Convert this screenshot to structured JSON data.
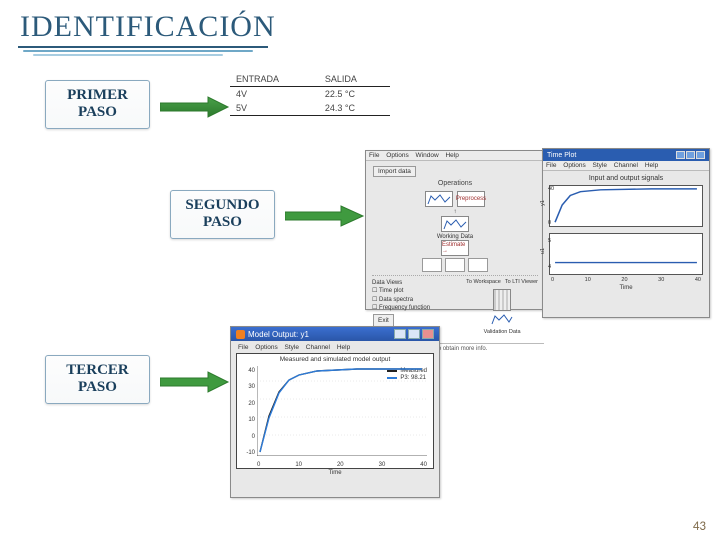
{
  "title": "IDENTIFICACIÓN",
  "page_number": "43",
  "steps": {
    "first": {
      "line1": "PRIMER",
      "line2": "PASO"
    },
    "second": {
      "line1": "SEGUNDO",
      "line2": "PASO"
    },
    "third": {
      "line1": "TERCER",
      "line2": "PASO"
    }
  },
  "entry_table": {
    "head_in": "ENTRADA",
    "head_out": "SALIDA",
    "rows": [
      {
        "in": "4V",
        "out": "22.5 °C"
      },
      {
        "in": "5V",
        "out": "24.3 °C"
      }
    ]
  },
  "ident_window": {
    "menu": [
      "File",
      "Options",
      "Window",
      "Help"
    ],
    "import_btn": "Import data",
    "section_title": "Operations",
    "preprocess": "Preprocess",
    "working_data": "Working Data",
    "estimate": "Estimate →",
    "data_views": "Data Views",
    "to_workspace": "To Workspace",
    "to_ltiviewer": "To LTI Viewer",
    "chk_time": "Time plot",
    "chk_data": "Data spectra",
    "chk_freq": "Frequency function",
    "exit": "Exit",
    "validation_data": "Validation Data",
    "status": "Click on data/model icon to obtain more info."
  },
  "io_plot": {
    "menu": [
      "File",
      "Options",
      "Style",
      "Channel",
      "Help"
    ],
    "title": "Input and output signals",
    "y1_ticks": [
      "40",
      "0"
    ],
    "y2_ticks": [
      "5",
      "4"
    ],
    "x_ticks": [
      "0",
      "10",
      "20",
      "30",
      "40"
    ],
    "xlabel": "Time"
  },
  "model_output": {
    "window_title": "Model Output: y1",
    "menu": [
      "File",
      "Options",
      "Style",
      "Channel",
      "Help"
    ],
    "plot_title": "Measured and simulated model output",
    "legend": [
      {
        "label": "Measured",
        "color": "#222222"
      },
      {
        "label": "P3: 98.21",
        "color": "#2d7bd8"
      }
    ],
    "y_ticks": [
      "40",
      "30",
      "20",
      "10",
      "0",
      "-10"
    ],
    "x_ticks": [
      "0",
      "10",
      "20",
      "30",
      "40"
    ],
    "xlabel": "Time"
  },
  "chart_data": [
    {
      "type": "line",
      "title": "Input and output signals (upper)",
      "x": [
        0,
        2,
        4,
        6,
        10,
        20,
        30,
        40
      ],
      "values": [
        0,
        18,
        30,
        36,
        39,
        40,
        40,
        40
      ],
      "xlabel": "Time",
      "ylabel": "y1",
      "ylim": [
        0,
        45
      ],
      "xlim": [
        0,
        40
      ]
    },
    {
      "type": "line",
      "title": "Input and output signals (lower)",
      "x": [
        0,
        40
      ],
      "values": [
        4,
        4
      ],
      "xlabel": "Time",
      "ylabel": "u1",
      "ylim": [
        3.5,
        5
      ],
      "xlim": [
        0,
        40
      ]
    },
    {
      "type": "line",
      "title": "Measured and simulated model output",
      "xlabel": "Time",
      "ylabel": "",
      "ylim": [
        -10,
        40
      ],
      "xlim": [
        0,
        40
      ],
      "x": [
        0,
        2,
        4,
        6,
        8,
        10,
        15,
        20,
        30,
        40
      ],
      "series": [
        {
          "name": "Measured",
          "values": [
            -5,
            15,
            28,
            33,
            36,
            37,
            38,
            39,
            40,
            40
          ]
        },
        {
          "name": "P3: 98.21",
          "values": [
            -5,
            14,
            27,
            33,
            36,
            37,
            38,
            39,
            40,
            40
          ]
        }
      ]
    }
  ]
}
